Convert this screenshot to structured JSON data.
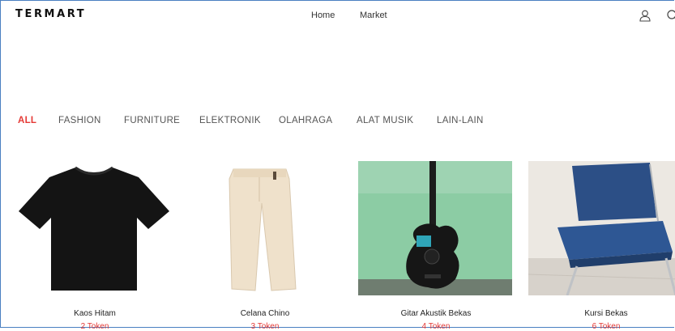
{
  "header": {
    "logo": "TERMART",
    "nav": {
      "home": "Home",
      "market": "Market"
    },
    "icons": [
      "user-icon",
      "search-icon"
    ]
  },
  "categories": {
    "tabs": [
      "ALL",
      "FASHION",
      "FURNITURE",
      "ELEKTRONIK",
      "OLAHRAGA",
      "ALAT MUSIK",
      "LAIN-LAIN"
    ],
    "active": "ALL",
    "active_color": "#e53935"
  },
  "products": [
    {
      "name": "Kaos Hitam",
      "price": "2 Token"
    },
    {
      "name": "Celana Chino",
      "price": "3 Token"
    },
    {
      "name": "Gitar Akustik Bekas",
      "price": "4 Token"
    },
    {
      "name": "Kursi Bekas",
      "price": "6 Token"
    }
  ],
  "colors": {
    "price": "#e53935",
    "frame_border": "#4a7fc1"
  }
}
